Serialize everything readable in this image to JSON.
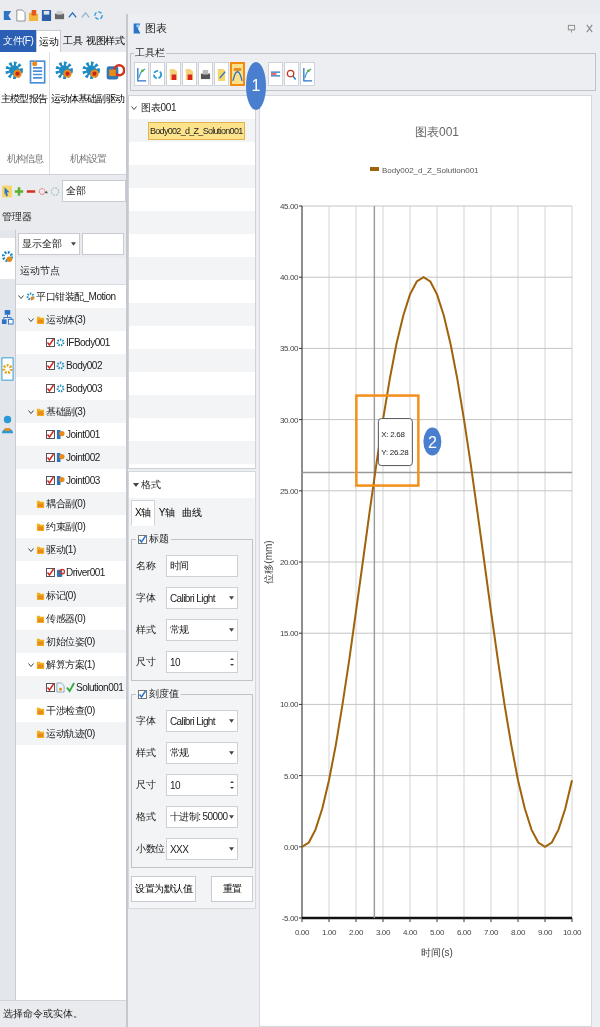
{
  "app": {
    "ribbon": {
      "tabs": [
        {
          "label": "文件(F)",
          "kind": "file",
          "selected": false
        },
        {
          "label": "运动",
          "kind": "tab",
          "selected": true
        },
        {
          "label": "工具",
          "kind": "tab",
          "selected": false
        },
        {
          "label": "视图样式",
          "kind": "tab",
          "selected": false
        }
      ],
      "groups": [
        {
          "label": "机构信息",
          "buttons": [
            {
              "label": "主模型",
              "kind": "gear"
            },
            {
              "label": "报告",
              "kind": "report"
            }
          ]
        },
        {
          "label": "机构设置",
          "buttons": [
            {
              "label": "运动体",
              "kind": "gear"
            },
            {
              "label": "基础副",
              "kind": "gear"
            },
            {
              "label": "驱动",
              "kind": "motor"
            }
          ]
        }
      ]
    },
    "filter": {
      "value": "全部"
    },
    "manager": {
      "title": "管理器",
      "display": "显示全部",
      "header": "运动节点",
      "tree": [
        {
          "label": "平口钳装配_Motion",
          "kind": "model",
          "expanded": true,
          "children": [
            {
              "label": "运动体(3)",
              "kind": "folder",
              "expanded": true,
              "children": [
                {
                  "label": "IFBody001",
                  "kind": "body",
                  "checked": true
                },
                {
                  "label": "Body002",
                  "kind": "body",
                  "checked": true
                },
                {
                  "label": "Body003",
                  "kind": "body",
                  "checked": true
                }
              ]
            },
            {
              "label": "基础副(3)",
              "kind": "folder",
              "expanded": true,
              "children": [
                {
                  "label": "Joint001",
                  "kind": "joint",
                  "checked": true
                },
                {
                  "label": "Joint002",
                  "kind": "joint",
                  "checked": true
                },
                {
                  "label": "Joint003",
                  "kind": "joint",
                  "checked": true
                }
              ]
            },
            {
              "label": "耦合副(0)",
              "kind": "folder",
              "expanded": false
            },
            {
              "label": "约束副(0)",
              "kind": "folder",
              "expanded": false
            },
            {
              "label": "驱动(1)",
              "kind": "folder",
              "expanded": true,
              "children": [
                {
                  "label": "Driver001",
                  "kind": "driver",
                  "checked": true
                }
              ]
            },
            {
              "label": "标记(0)",
              "kind": "folder",
              "expanded": false
            },
            {
              "label": "传感器(0)",
              "kind": "folder",
              "expanded": false
            },
            {
              "label": "初始位姿(0)",
              "kind": "folder",
              "expanded": false
            },
            {
              "label": "解算方案(1)",
              "kind": "folder",
              "expanded": true,
              "children": [
                {
                  "label": "Solution001",
                  "kind": "solution",
                  "checked": true
                }
              ]
            },
            {
              "label": "干涉检查(0)",
              "kind": "folder",
              "expanded": false
            },
            {
              "label": "运动轨迹(0)",
              "kind": "folder",
              "expanded": false
            }
          ]
        }
      ]
    },
    "status_bar": "选择命令或实体。"
  },
  "dialog": {
    "title": "图表",
    "toolbar": {
      "label": "工具栏",
      "buttons": [
        {
          "kind": "chart",
          "highlighted": false
        },
        {
          "kind": "refresh",
          "highlighted": false
        },
        {
          "kind": "export",
          "highlighted": false
        },
        {
          "kind": "export",
          "highlighted": false
        },
        {
          "kind": "print",
          "highlighted": false
        },
        {
          "kind": "edit",
          "highlighted": false
        },
        {
          "kind": "curve",
          "highlighted": true
        },
        {
          "kind": "split",
          "highlighted": false
        },
        {
          "kind": "search",
          "highlighted": false
        },
        {
          "kind": "chart",
          "highlighted": false
        }
      ]
    },
    "chart_list": [
      {
        "label": "图表001",
        "expanded": true,
        "selected": false,
        "children": [
          {
            "label": "Body002_d_Z_Solution001",
            "selected": true
          }
        ]
      }
    ],
    "format": {
      "title": "格式",
      "expanded": true,
      "tabs": [
        {
          "label": "X轴",
          "selected": true
        },
        {
          "label": "Y轴",
          "selected": false
        },
        {
          "label": "曲线",
          "selected": false
        }
      ],
      "groups": [
        {
          "label": "标题",
          "checked": true,
          "rows": [
            {
              "label": "名称",
              "kind": "text",
              "value": "时间"
            },
            {
              "label": "字体",
              "kind": "select",
              "value": "Calibri Light"
            },
            {
              "label": "样式",
              "kind": "select",
              "value": "常规"
            },
            {
              "label": "尺寸",
              "kind": "spin",
              "value": "10"
            }
          ]
        },
        {
          "label": "刻度值",
          "checked": true,
          "rows": [
            {
              "label": "字体",
              "kind": "select",
              "value": "Calibri Light"
            },
            {
              "label": "样式",
              "kind": "select",
              "value": "常规"
            },
            {
              "label": "尺寸",
              "kind": "spin",
              "value": "10"
            },
            {
              "label": "格式",
              "kind": "select",
              "value": "十进制: 50000"
            },
            {
              "label": "小数位",
              "kind": "select",
              "value": "XXX"
            }
          ]
        }
      ],
      "buttons": [
        "设置为默认值",
        "重置"
      ]
    },
    "chart": {
      "chart_data": {
        "type": "line",
        "title": "图表001",
        "xlabel": "时间(s)",
        "ylabel": "位移(mm)",
        "x": [
          0,
          0.25,
          0.5,
          0.75,
          1,
          1.25,
          1.5,
          1.75,
          2,
          2.25,
          2.5,
          2.75,
          3,
          3.25,
          3.5,
          3.75,
          4,
          4.25,
          4.5,
          4.75,
          5,
          5.25,
          5.5,
          5.75,
          6,
          6.25,
          6.5,
          6.75,
          7,
          7.25,
          7.5,
          7.75,
          8,
          8.25,
          8.5,
          8.75,
          9,
          9.25,
          9.5,
          9.75,
          10
        ],
        "series": [
          {
            "name": "Body002_d_Z_Solution001",
            "color": "#a0620a",
            "values": [
              0,
              0.3,
              1.21,
              2.68,
              4.68,
              7.14,
              10,
              13.16,
              16.53,
              20,
              23.47,
              26.84,
              30,
              32.86,
              35.32,
              37.32,
              38.79,
              39.7,
              40,
              39.7,
              38.79,
              37.32,
              35.32,
              32.86,
              30,
              26.84,
              23.47,
              20,
              16.53,
              13.16,
              10,
              7.14,
              4.68,
              2.68,
              1.21,
              0.3,
              0,
              0.3,
              1.21,
              2.68,
              4.68
            ]
          }
        ],
        "xlim": [
          0,
          10
        ],
        "ylim": [
          -5,
          45
        ],
        "xticks": [
          {
            "value": 0,
            "label": "0.00"
          },
          {
            "value": 1,
            "label": "1.00"
          },
          {
            "value": 2,
            "label": "2.00"
          },
          {
            "value": 3,
            "label": "3.00"
          },
          {
            "value": 4,
            "label": "4.00"
          },
          {
            "value": 5,
            "label": "5.00"
          },
          {
            "value": 6,
            "label": "6.00"
          },
          {
            "value": 7,
            "label": "7.00"
          },
          {
            "value": 8,
            "label": "8.00"
          },
          {
            "value": 9,
            "label": "9.00"
          },
          {
            "value": 10,
            "label": "10.00"
          }
        ],
        "yticks": [
          {
            "value": -5,
            "label": "-5.00"
          },
          {
            "value": 0,
            "label": "0.00"
          },
          {
            "value": 5,
            "label": "5.00"
          },
          {
            "value": 10,
            "label": "10.00"
          },
          {
            "value": 15,
            "label": "15.00"
          },
          {
            "value": 20,
            "label": "20.00"
          },
          {
            "value": 25,
            "label": "25.00"
          },
          {
            "value": 30,
            "label": "30.00"
          },
          {
            "value": 35,
            "label": "35.00"
          },
          {
            "value": 40,
            "label": "40.00"
          },
          {
            "value": 45,
            "label": "45.00"
          }
        ],
        "grid": true,
        "ref_lines": [
          {
            "axis": "x",
            "value": 2.68
          },
          {
            "axis": "y",
            "value": 26.28
          }
        ],
        "annotations": [
          {
            "text": "X: 2.68\nY: 26.28"
          }
        ]
      }
    },
    "callouts": [
      {
        "label": "1"
      },
      {
        "label": "2"
      }
    ]
  }
}
